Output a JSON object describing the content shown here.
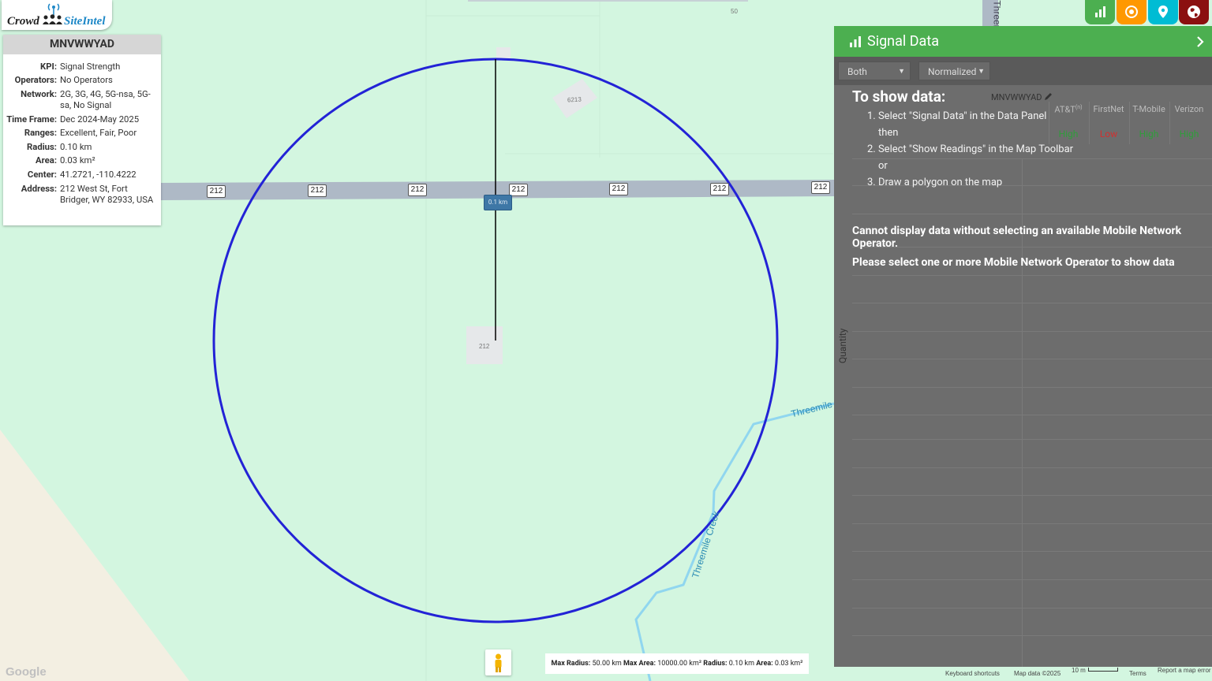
{
  "app": {
    "logo_left": "Crowd",
    "logo_right": "SiteIntel"
  },
  "info_card": {
    "title": "MNVWWYAD",
    "rows": [
      {
        "key": "KPI:",
        "value": "Signal Strength"
      },
      {
        "key": "Operators:",
        "value": "No Operators"
      },
      {
        "key": "Network:",
        "value": "2G, 3G, 4G, 5G-nsa, 5G-sa, No Signal"
      },
      {
        "key": "Time Frame:",
        "value": "Dec 2024-May 2025"
      },
      {
        "key": "Ranges:",
        "value": "Excellent, Fair, Poor"
      },
      {
        "key": "Radius:",
        "value": "0.10 km"
      },
      {
        "key": "Area:",
        "value": "0.03 km²"
      },
      {
        "key": "Center:",
        "value": "41.2721, -110.4222"
      },
      {
        "key": "Address:",
        "value": "212 West St, Fort Bridger, WY 82933, USA"
      }
    ]
  },
  "map": {
    "road_shield": "212",
    "distance_label": "0.1 km",
    "marker_50": "50",
    "marker_6213": "6213",
    "marker_212": "212",
    "creek_name_1": "Threemile",
    "creek_name_2": "Threemile Creek",
    "street_vertical": "Threem",
    "google_logo": "Google",
    "limits": {
      "max_radius_label": "Max Radius:",
      "max_radius_value": "50.00 km",
      "max_area_label": "Max Area:",
      "max_area_value": "10000.00 km²",
      "radius_label": "Radius:",
      "radius_value": "0.10 km",
      "area_label": "Area:",
      "area_value": "0.03 km²"
    },
    "footer": {
      "shortcuts": "Keyboard shortcuts",
      "map_data": "Map data ©2025",
      "scale": "10 m",
      "terms": "Terms",
      "report": "Report a map error"
    }
  },
  "toolbar": {
    "buttons": [
      {
        "name": "signal-data-button",
        "color": "#4caf50",
        "icon": "bar-chart-icon"
      },
      {
        "name": "target-button",
        "color": "#ff9800",
        "icon": "target-icon"
      },
      {
        "name": "location-button",
        "color": "#00bcd4",
        "icon": "map-pin-icon"
      },
      {
        "name": "globe-button",
        "color": "#8b1010",
        "icon": "globe-icon"
      }
    ]
  },
  "signal_panel": {
    "title": "Signal Data",
    "select_direction": "Both",
    "select_mode": "Normalized",
    "show_title": "To show data:",
    "steps": [
      "1. Select \"Signal Data\" in the Data Panel",
      "then",
      "2. Select \"Show Readings\" in the Map Toolbar",
      "or",
      "3. Draw a polygon on the map"
    ],
    "warning_1": "Cannot display data without selecting an available Mobile Network Operator.",
    "warning_2": "Please select one or more Mobile Network Operator to show data",
    "axis_label": "Quantity",
    "site_name": "MNVWWYAD",
    "operators": [
      {
        "name": "AT&T",
        "sup": "(n)",
        "value": "High",
        "color": "#2e9e3a"
      },
      {
        "name": "FirstNet",
        "sup": "",
        "value": "Low",
        "color": "#d32f2f"
      },
      {
        "name": "T-Mobile",
        "sup": "",
        "value": "High",
        "color": "#2e9e3a"
      },
      {
        "name": "Verizon",
        "sup": "",
        "value": "High",
        "color": "#2e9e3a"
      }
    ]
  }
}
